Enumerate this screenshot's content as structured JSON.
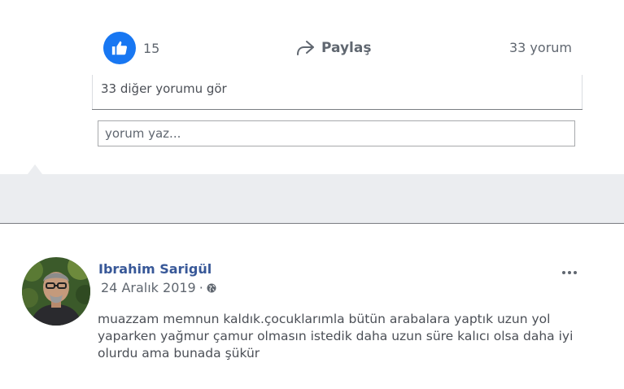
{
  "actions": {
    "like_count": "15",
    "share_label": "Paylaş",
    "comment_count_label": "33 yorum"
  },
  "comments": {
    "view_more_label": "33 diğer yorumu gör",
    "input_placeholder": "yorum yaz..."
  },
  "post": {
    "author": "Ibrahim Sarigül",
    "date": "24 Aralık 2019",
    "separator": "·",
    "privacy_icon": "globe-icon",
    "text": "muazzam memnun kaldık.çocuklarımla bütün arabalara yaptık uzun yol yaparken yağmur çamur olmasın istedik daha uzun süre kalıcı olsa daha iyi olurdu ama bunada şükür"
  },
  "colors": {
    "like_blue": "#1877f2",
    "author_blue": "#385898",
    "band_gray": "#ebedf0"
  }
}
